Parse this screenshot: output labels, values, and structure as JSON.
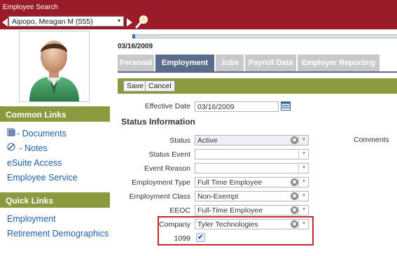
{
  "header": {
    "title": "Employee Search"
  },
  "search": {
    "selected_employee": "Aipopo, Meagan M (555)",
    "dropdown_glyph": "▾"
  },
  "sidebar": {
    "common_links_title": "Common Links",
    "common_links": [
      {
        "label": "- Documents",
        "icon": "document-icon"
      },
      {
        "label": " - Notes",
        "icon": "notes-icon"
      },
      {
        "label": "eSuite Access"
      },
      {
        "label": "Employee Service"
      }
    ],
    "quick_links_title": "Quick Links",
    "quick_links": [
      {
        "label": "Employment"
      },
      {
        "label": "Retirement Demographics"
      }
    ]
  },
  "timeline": {
    "date": "03/16/2009",
    "progress": 0.01
  },
  "tabs": [
    {
      "label": "Personal",
      "active": false
    },
    {
      "label": "Employment",
      "active": true
    },
    {
      "label": "Jobs",
      "active": false
    },
    {
      "label": "Payroll Data",
      "active": false
    },
    {
      "label": "Employer Reporting",
      "active": false
    }
  ],
  "toolbar": {
    "save_label": "Save",
    "cancel_label": "Cancel"
  },
  "form": {
    "effective_date_label": "Effective Date",
    "effective_date_value": "03/16/2009",
    "status_section_title": "Status Information",
    "status_label": "Status",
    "status_value": "Active",
    "comments_label": "Comments",
    "status_event_label": "Status Event",
    "status_event_value": "",
    "event_reason_label": "Event Reason",
    "event_reason_value": "",
    "employment_type_label": "Employment Type",
    "employment_type_value": "Full Time Employee",
    "employment_class_label": "Employment Class",
    "employment_class_value": "Non-Exempt",
    "eeoc_label": "EEOC",
    "eeoc_value": "Full-Time Employee",
    "company_label": "Company",
    "company_value": "Tyler Technologies",
    "ten99_label": "1099",
    "ten99_checked": true
  },
  "colors": {
    "brand": "#9a1b2a",
    "section": "#8a9a3e",
    "active_tab": "#5a6b8c",
    "inactive_tab": "#c7c9cc",
    "link": "#1f5ea8",
    "highlight": "#c62828"
  },
  "glyphs": {
    "clear": "✖",
    "dropdown": "▾",
    "check": "✔"
  }
}
